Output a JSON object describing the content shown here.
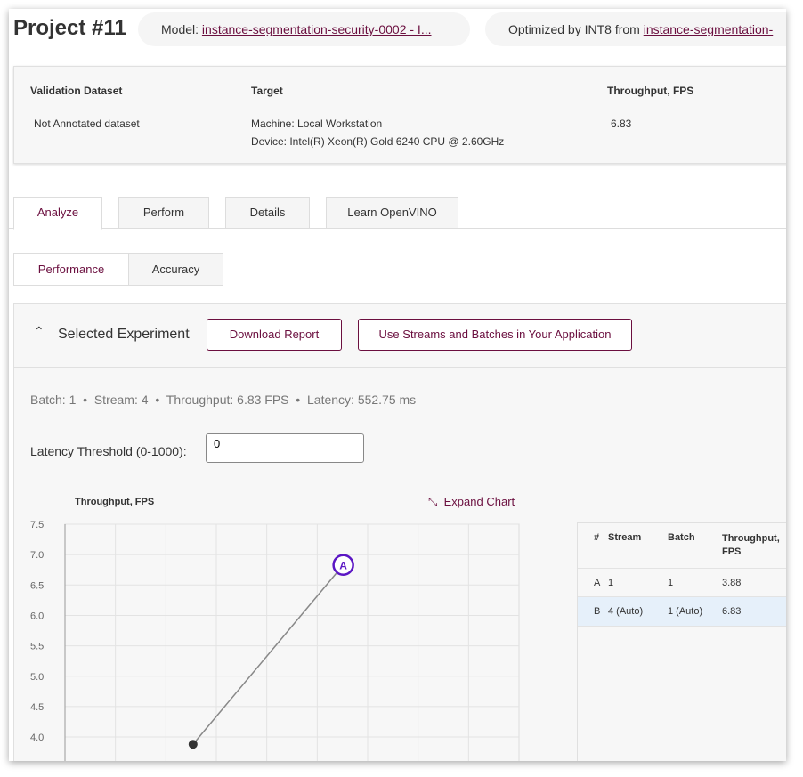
{
  "header": {
    "title": "Project #11",
    "model_label": "Model: ",
    "model_link": "instance-segmentation-security-0002 - I...",
    "optimized_label": "Optimized by INT8 from ",
    "optimized_link": "instance-segmentation-"
  },
  "info": {
    "dataset_header": "Validation Dataset",
    "dataset_value": "Not Annotated dataset",
    "target_header": "Target",
    "machine": "Machine: Local Workstation",
    "device": "Device: Intel(R) Xeon(R) Gold 6240 CPU @ 2.60GHz",
    "throughput_header": "Throughput, FPS",
    "throughput_value": "6.83"
  },
  "tabs": [
    {
      "label": "Analyze",
      "active": true
    },
    {
      "label": "Perform"
    },
    {
      "label": "Details"
    },
    {
      "label": "Learn OpenVINO"
    }
  ],
  "subtabs": [
    {
      "label": "Performance",
      "active": true
    },
    {
      "label": "Accuracy"
    }
  ],
  "experiment": {
    "title": "Selected Experiment",
    "download": "Download Report",
    "streams": "Use Streams and Batches in Your Application",
    "summary": {
      "batch": "Batch: 1",
      "stream": "Stream: 4",
      "throughput": "Throughput: 6.83 FPS",
      "latency": "Latency: 552.75 ms"
    },
    "threshold_label": "Latency Threshold (0-1000):",
    "threshold_value": "0",
    "expand": "Expand Chart"
  },
  "table": {
    "headers": [
      "#",
      "Stream",
      "Batch",
      "Throughput,\nFPS"
    ],
    "rows": [
      {
        "id": "A",
        "stream": "1",
        "batch": "1",
        "fps": "3.88",
        "selected": false
      },
      {
        "id": "B",
        "stream": "4 (Auto)",
        "batch": "1 (Auto)",
        "fps": "6.83",
        "selected": true
      }
    ]
  },
  "colors": {
    "accent": "#6b0f3f",
    "marker": "#5b16c4",
    "selected_row": "#e6f0fa"
  },
  "chart_data": {
    "type": "scatter",
    "ylabel": "Throughput, FPS",
    "yticks": [
      "7.5",
      "7.0",
      "6.5",
      "6.0",
      "5.5",
      "5.0",
      "4.5",
      "4.0"
    ],
    "ylim": [
      3.6,
      7.5
    ],
    "grid": true,
    "points": [
      {
        "y": 3.88
      },
      {
        "y": 6.83,
        "label": "A"
      }
    ]
  }
}
